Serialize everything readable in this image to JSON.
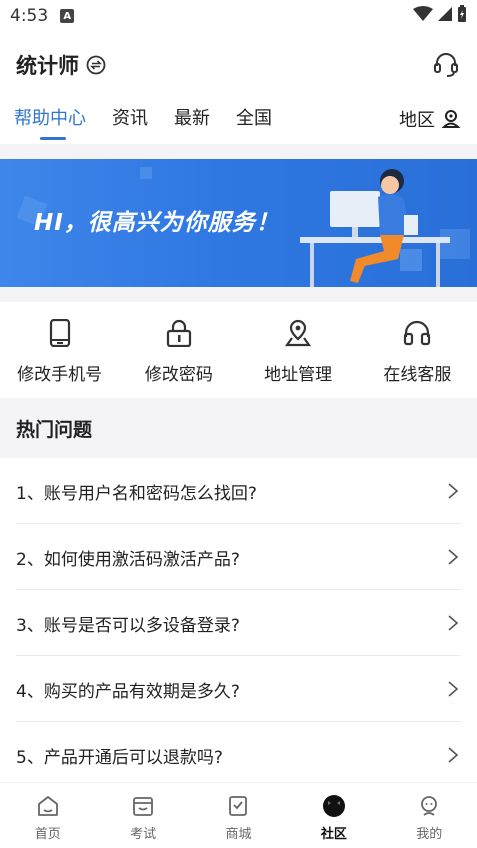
{
  "status_bar": {
    "time": "4:53",
    "notification_badge": "A"
  },
  "header": {
    "title": "统计师"
  },
  "tabs": [
    {
      "label": "帮助中心",
      "active": true
    },
    {
      "label": "资讯",
      "active": false
    },
    {
      "label": "最新",
      "active": false
    },
    {
      "label": "全国",
      "active": false
    }
  ],
  "region": {
    "label": "地区",
    "icon": "person-location-icon"
  },
  "banner": {
    "text": "HI，很高兴为你服务！"
  },
  "quick_actions": [
    {
      "label": "修改手机号",
      "icon": "phone-icon"
    },
    {
      "label": "修改密码",
      "icon": "lock-icon"
    },
    {
      "label": "地址管理",
      "icon": "map-pin-icon"
    },
    {
      "label": "在线客服",
      "icon": "headphones-icon"
    }
  ],
  "hot_questions": {
    "title": "热门问题",
    "items": [
      "1、账号用户名和密码怎么找回?",
      "2、如何使用激活码激活产品?",
      "3、账号是否可以多设备登录?",
      "4、购买的产品有效期是多久?",
      "5、产品开通后可以退款吗?"
    ]
  },
  "bottom_nav": [
    {
      "label": "首页",
      "icon": "home-icon",
      "active": false
    },
    {
      "label": "考试",
      "icon": "calendar-icon",
      "active": false
    },
    {
      "label": "商城",
      "icon": "cart-icon",
      "active": false
    },
    {
      "label": "社区",
      "icon": "community-icon",
      "active": true
    },
    {
      "label": "我的",
      "icon": "profile-icon",
      "active": false
    }
  ],
  "colors": {
    "accent": "#2f76ce",
    "banner": "#2f78e2",
    "section_bg": "#f4f4f6"
  }
}
